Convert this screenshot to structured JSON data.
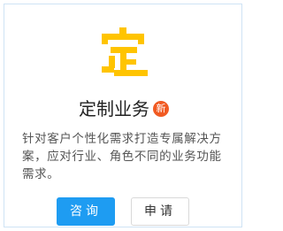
{
  "card": {
    "logo_icon": "ding-character-logo-icon",
    "title": "定制业务",
    "badge": "新",
    "description": "针对客户个性化需求打造专属解决方案，应对行业、角色不同的业务功能需求。",
    "consult_label": "咨询",
    "apply_label": "申请"
  },
  "colors": {
    "logo": "#ffc400",
    "badge": "#f15a22",
    "primary": "#1e9cf2",
    "border": "#cfe3f5"
  }
}
